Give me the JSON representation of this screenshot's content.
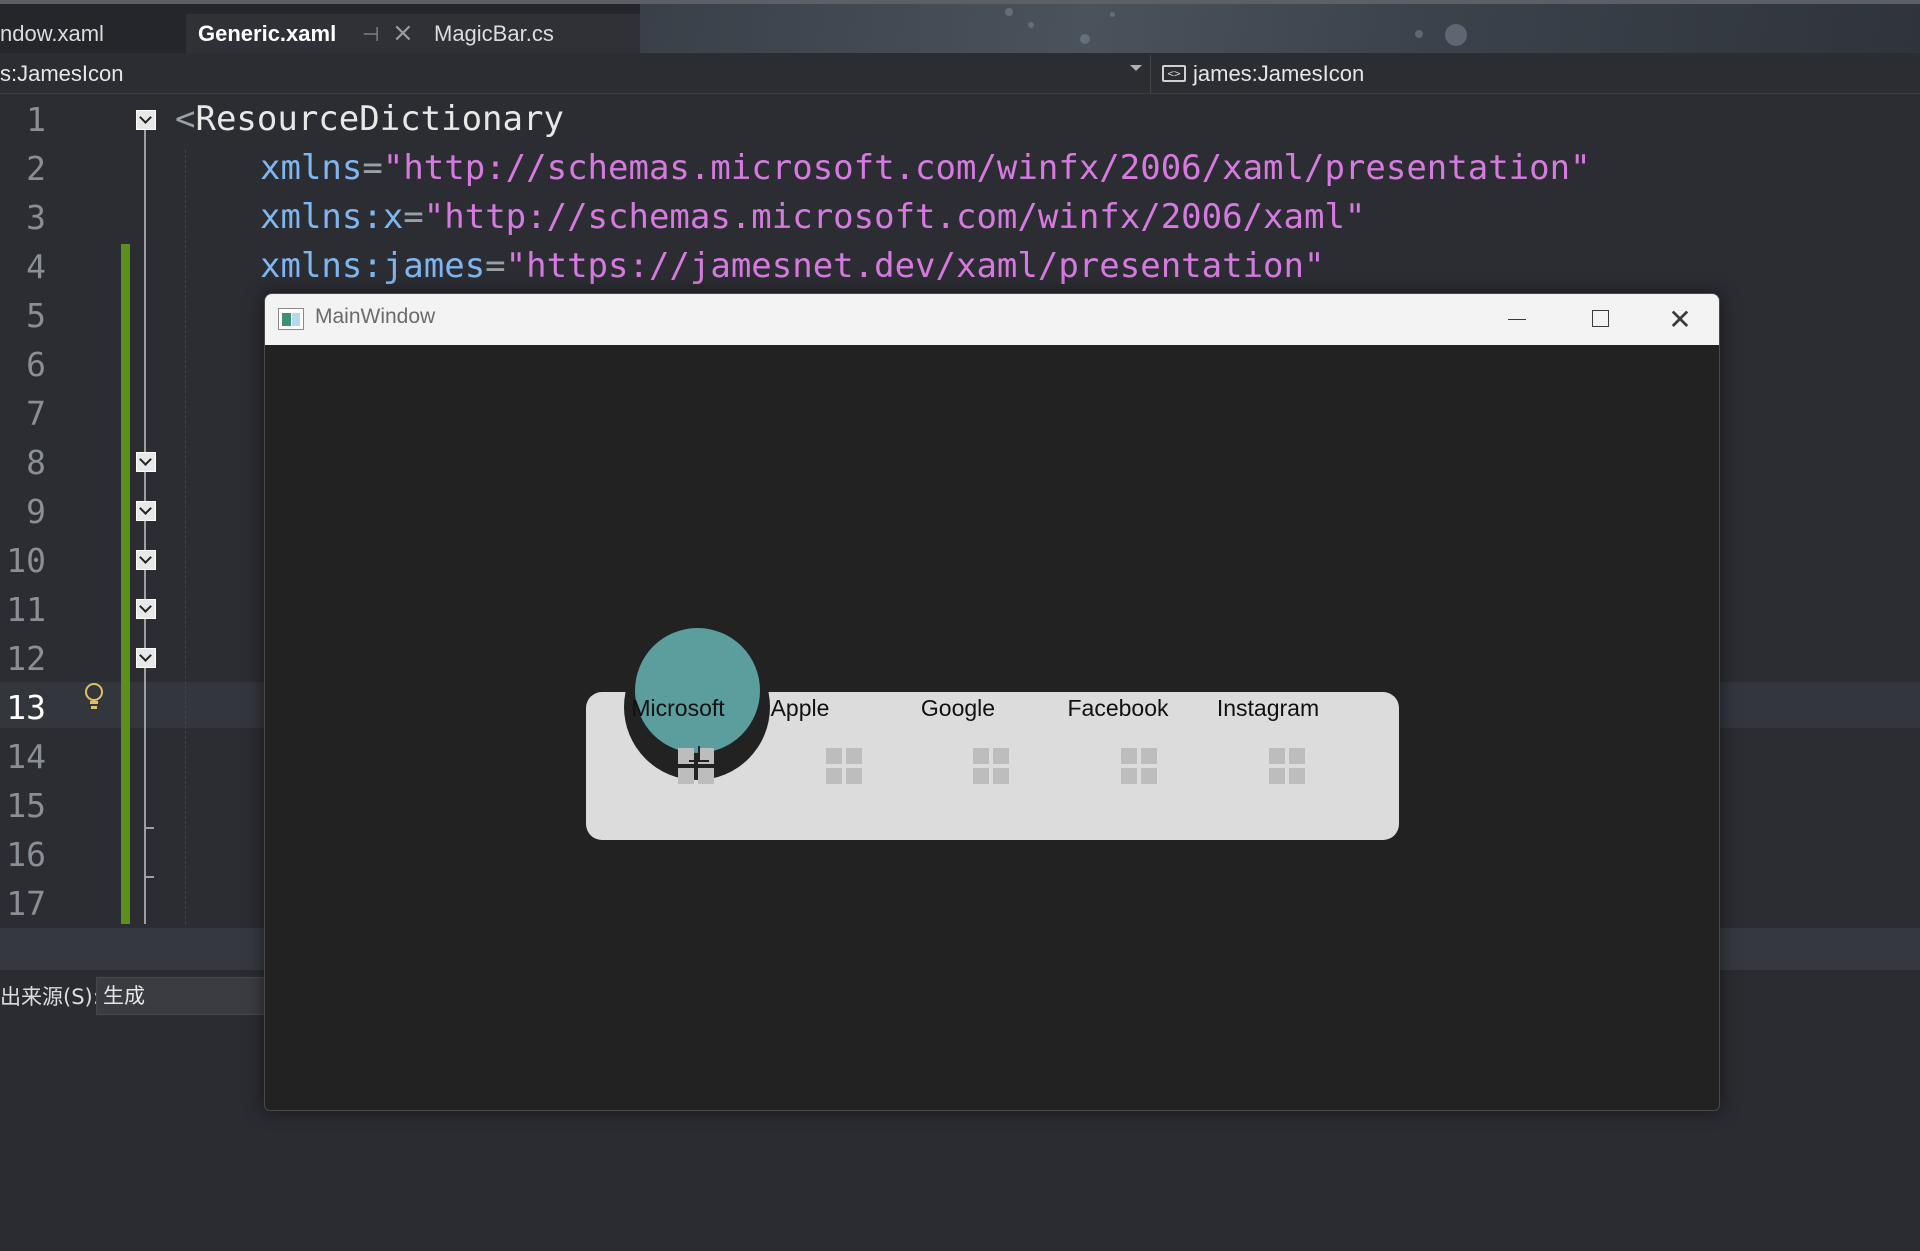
{
  "tabs": [
    {
      "label": "ndow.xaml",
      "active": false
    },
    {
      "label": "Generic.xaml",
      "active": true
    },
    {
      "label": "MagicBar.cs",
      "active": false
    }
  ],
  "tab_icons": {
    "pin": "pin-icon",
    "close": "close-icon"
  },
  "navbar": {
    "left_scope": "s:JamesIcon",
    "right_member": "james:JamesIcon"
  },
  "editor": {
    "line_numbers": [
      "1",
      "2",
      "3",
      "4",
      "5",
      "6",
      "7",
      "8",
      "9",
      "10",
      "11",
      "12",
      "13",
      "14",
      "15",
      "16",
      "17"
    ],
    "current_line": "13",
    "code": {
      "line1": {
        "open": "<",
        "tag": "ResourceDictionary"
      },
      "line2": {
        "attr": "xmlns",
        "eq": "=",
        "value": "\"http://schemas.microsoft.com/winfx/2006/xaml/presentation\""
      },
      "line3": {
        "attr": "xmlns:x",
        "eq": "=",
        "value": "\"http://schemas.microsoft.com/winfx/2006/xaml\""
      },
      "line4": {
        "attr": "xmlns:james",
        "eq": "=",
        "value": "\"https://jamesnet.dev/xaml/presentation\""
      }
    }
  },
  "output": {
    "label": "出来源(S):",
    "source": "生成"
  },
  "window": {
    "title": "MainWindow",
    "close_glyph": "✕",
    "magic_bar": {
      "selected": "Microsoft",
      "items": [
        "Microsoft",
        "Apple",
        "Google",
        "Facebook",
        "Instagram"
      ],
      "accent_color": "#5b9e9d",
      "bar_color": "#dcdcdc"
    }
  }
}
